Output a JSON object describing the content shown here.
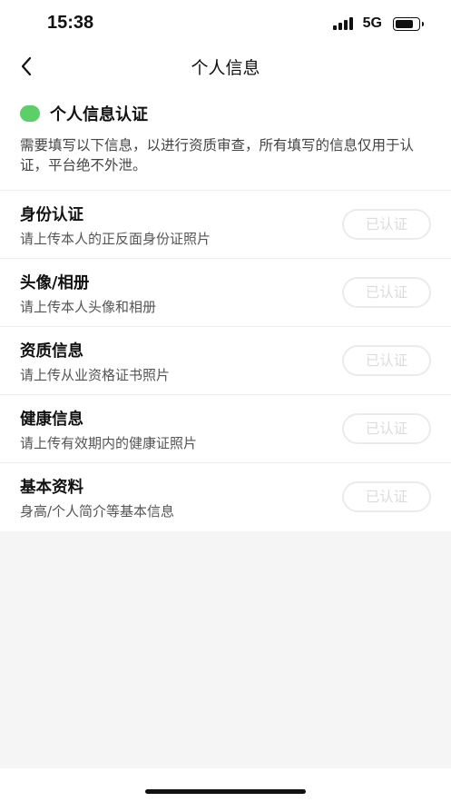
{
  "status_bar": {
    "time": "15:38",
    "network": "5G"
  },
  "nav": {
    "title": "个人信息",
    "back_icon": "chevron-left-icon"
  },
  "intro": {
    "title": "个人信息认证",
    "description": "需要填写以下信息，以进行资质审查，所有填写的信息仅用于认证，平台绝不外泄。",
    "accent_color": "#5ccf68"
  },
  "items": [
    {
      "title": "身份认证",
      "description": "请上传本人的正反面身份证照片",
      "button": "已认证"
    },
    {
      "title": "头像/相册",
      "description": "请上传本人头像和相册",
      "button": "已认证"
    },
    {
      "title": "资质信息",
      "description": "请上传从业资格证书照片",
      "button": "已认证"
    },
    {
      "title": "健康信息",
      "description": "请上传有效期内的健康证照片",
      "button": "已认证"
    },
    {
      "title": "基本资料",
      "description": "身高/个人简介等基本信息",
      "button": "已认证"
    }
  ]
}
